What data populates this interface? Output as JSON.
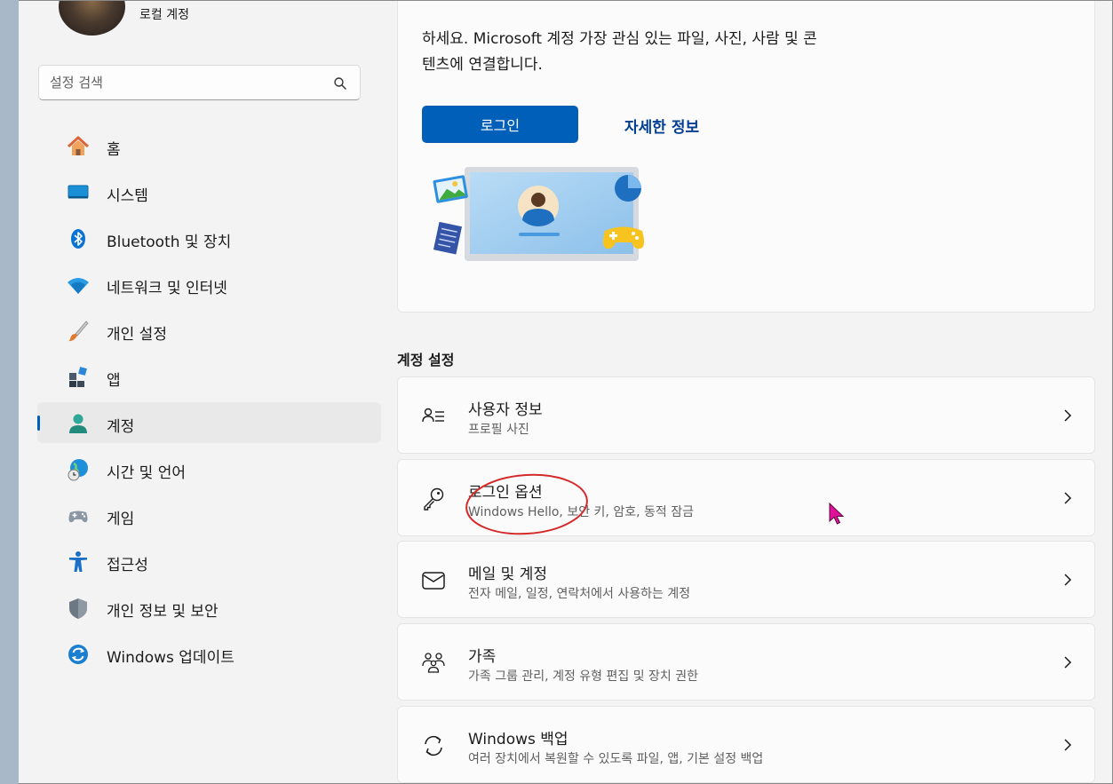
{
  "profile": {
    "account_type": "로컬 계정"
  },
  "search": {
    "placeholder": "설정 검색"
  },
  "nav": {
    "items": [
      {
        "label": "홈"
      },
      {
        "label": "시스템"
      },
      {
        "label": "Bluetooth 및 장치"
      },
      {
        "label": "네트워크 및 인터넷"
      },
      {
        "label": "개인 설정"
      },
      {
        "label": "앱"
      },
      {
        "label": "계정"
      },
      {
        "label": "시간 및 언어"
      },
      {
        "label": "게임"
      },
      {
        "label": "접근성"
      },
      {
        "label": "개인 정보 및 보안"
      },
      {
        "label": "Windows 업데이트"
      }
    ],
    "active_index": 6
  },
  "hero": {
    "text_line1": "하세요. Microsoft 계정 가장 관심 있는 파일, 사진, 사람 및 콘",
    "text_line2": "텐츠에 연결합니다.",
    "signin_label": "로그인",
    "more_info_label": "자세한 정보"
  },
  "account_settings": {
    "title": "계정 설정",
    "cards": [
      {
        "title": "사용자 정보",
        "subtitle": "프로필 사진",
        "icon": "user-info-icon"
      },
      {
        "title": "로그인 옵션",
        "subtitle": "Windows Hello, 보안 키, 암호, 동적 잠금",
        "icon": "key-icon"
      },
      {
        "title": "메일 및 계정",
        "subtitle": "전자 메일, 일정, 연락처에서 사용하는 계정",
        "icon": "mail-icon"
      },
      {
        "title": "가족",
        "subtitle": "가족 그룹 관리, 계정 유형 편집 및 장치 권한",
        "icon": "family-icon"
      },
      {
        "title": "Windows 백업",
        "subtitle": "여러 장치에서 복원할 수 있도록 파일, 앱, 기본 설정 백업",
        "icon": "backup-icon"
      }
    ]
  },
  "colors": {
    "accent": "#005fb8",
    "link": "#003e92",
    "annotation": "#d42a2a",
    "cursor": "#e0109a"
  }
}
